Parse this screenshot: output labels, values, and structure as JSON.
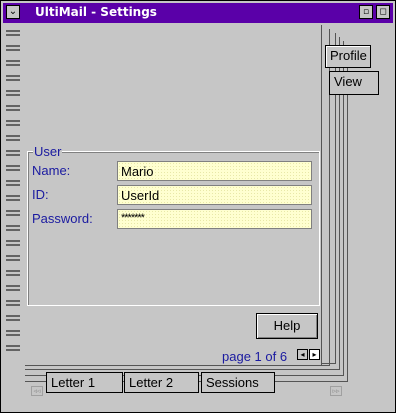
{
  "window": {
    "title": "UltiMail  -  Settings",
    "sysmenu_glyph": "⌄",
    "minimize_glyph": "▫",
    "maximize_glyph": "◻"
  },
  "tabs_right": [
    {
      "label": "Profile"
    },
    {
      "label": "View"
    }
  ],
  "tabs_bottom": [
    {
      "label": "Letter 1"
    },
    {
      "label": "Letter 2"
    },
    {
      "label": "Sessions"
    }
  ],
  "group": {
    "label": "User",
    "fields": [
      {
        "label": "Name:",
        "value": "Mario"
      },
      {
        "label": "ID:",
        "value": "UserId"
      },
      {
        "label": "Password:",
        "value": "*******"
      }
    ]
  },
  "help_label": "Help",
  "page_indicator": "page 1 of 6",
  "prev_page_glyph": "◂",
  "next_page_glyph": "▸",
  "scroll_left_glyph": "◃◃",
  "scroll_right_glyph": "▹▹",
  "colors": {
    "titlebar": "#5a00a8",
    "label_blue": "#1a1aa0",
    "field_bg": "#ffffd0",
    "window_bg": "#c6c6c6"
  }
}
